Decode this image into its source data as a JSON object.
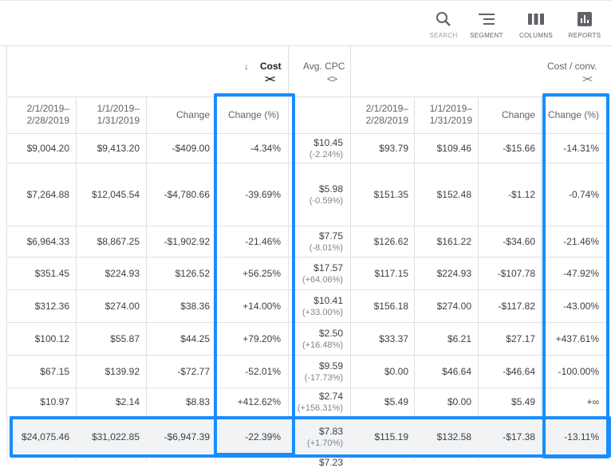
{
  "toolbar": {
    "search": "SEARCH",
    "segment": "SEGMENT",
    "columns": "COLUMNS",
    "reports": "REPORTS"
  },
  "headers": {
    "cost": "Cost",
    "avg_cpc": "Avg. CPC",
    "cost_per_conv": "Cost / conv.",
    "expand_glyph": "><",
    "collapse_glyph": "<>",
    "sort_glyph": "↓"
  },
  "subheaders": {
    "period_a": "2/1/2019–\n2/28/2019",
    "period_b": "1/1/2019–\n1/31/2019",
    "change": "Change",
    "change_pct": "Change (%)"
  },
  "rows": [
    {
      "c1": "$9,004.20",
      "c2": "$9,413.20",
      "c3": "-$409.00",
      "c4": "-4.34%",
      "cpc": "$10.45",
      "cpc_sub": "(-2.24%)",
      "d1": "$93.79",
      "d2": "$109.46",
      "d3": "-$15.66",
      "d4": "-14.31%"
    },
    {
      "c1": "$7,264.88",
      "c2": "$12,045.54",
      "c3": "-$4,780.66",
      "c4": "-39.69%",
      "cpc": "$5.98",
      "cpc_sub": "(-0.59%)",
      "d1": "$151.35",
      "d2": "$152.48",
      "d3": "-$1.12",
      "d4": "-0.74%"
    },
    {
      "c1": "$6,964.33",
      "c2": "$8,867.25",
      "c3": "-$1,902.92",
      "c4": "-21.46%",
      "cpc": "$7.75",
      "cpc_sub": "(-8.01%)",
      "d1": "$126.62",
      "d2": "$161.22",
      "d3": "-$34.60",
      "d4": "-21.46%"
    },
    {
      "c1": "$351.45",
      "c2": "$224.93",
      "c3": "$126.52",
      "c4": "+56.25%",
      "cpc": "$17.57",
      "cpc_sub": "(+64.06%)",
      "d1": "$117.15",
      "d2": "$224.93",
      "d3": "-$107.78",
      "d4": "-47.92%"
    },
    {
      "c1": "$312.36",
      "c2": "$274.00",
      "c3": "$38.36",
      "c4": "+14.00%",
      "cpc": "$10.41",
      "cpc_sub": "(+33.00%)",
      "d1": "$156.18",
      "d2": "$274.00",
      "d3": "-$117.82",
      "d4": "-43.00%"
    },
    {
      "c1": "$100.12",
      "c2": "$55.87",
      "c3": "$44.25",
      "c4": "+79.20%",
      "cpc": "$2.50",
      "cpc_sub": "(+16.48%)",
      "d1": "$33.37",
      "d2": "$6.21",
      "d3": "$27.17",
      "d4": "+437.61%"
    },
    {
      "c1": "$67.15",
      "c2": "$139.92",
      "c3": "-$72.77",
      "c4": "-52.01%",
      "cpc": "$9.59",
      "cpc_sub": "(-17.73%)",
      "d1": "$0.00",
      "d2": "$46.64",
      "d3": "-$46.64",
      "d4": "-100.00%"
    },
    {
      "c1": "$10.97",
      "c2": "$2.14",
      "c3": "$8.83",
      "c4": "+412.62%",
      "cpc": "$2.74",
      "cpc_sub": "(+156.31%)",
      "d1": "$5.49",
      "d2": "$0.00",
      "d3": "$5.49",
      "d4": "+∞"
    }
  ],
  "totals": {
    "c1": "$24,075.46",
    "c2": "$31,022.85",
    "c3": "-$6,947.39",
    "c4": "-22.39%",
    "cpc": "$7.83",
    "cpc_sub": "(+1.70%)",
    "d1": "$115.19",
    "d2": "$132.58",
    "d3": "-$17.38",
    "d4": "-13.11%"
  },
  "partial_row_cpc": "$7.23",
  "colors": {
    "highlight": "#1a8cff",
    "border": "#e0e0e0",
    "totals_bg": "#f1f3f4"
  }
}
